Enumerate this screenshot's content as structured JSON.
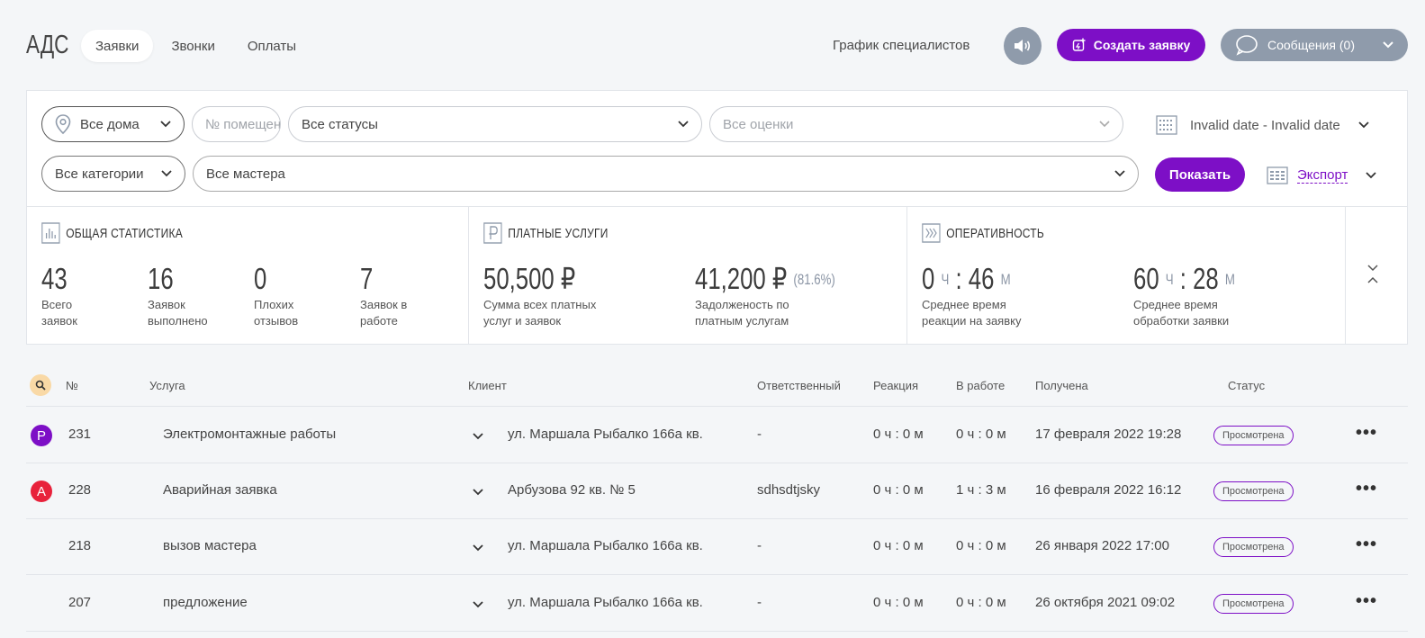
{
  "app": {
    "logo": "АДС"
  },
  "nav": {
    "tabs": [
      {
        "label": "Заявки",
        "active": true
      },
      {
        "label": "Звонки",
        "active": false
      },
      {
        "label": "Оплаты",
        "active": false
      }
    ],
    "schedule_label": "График специалистов",
    "create_label": "Создать заявку",
    "messages_label": "Сообщения (0)"
  },
  "filters": {
    "houses": "Все дома",
    "room_placeholder": "№ помещения",
    "statuses": "Все статусы",
    "ratings_placeholder": "Все оценки",
    "date_range": "Invalid date - Invalid date",
    "categories": "Все категории",
    "masters": "Все мастера",
    "show_label": "Показать",
    "export_label": "Экспорт"
  },
  "stats": {
    "general": {
      "title": "ОБЩАЯ СТАТИСТИКА",
      "items": [
        {
          "value": "43",
          "caption_1": "Всего",
          "caption_2": "заявок"
        },
        {
          "value": "16",
          "caption_1": "Заявок",
          "caption_2": "выполнено"
        },
        {
          "value": "0",
          "caption_1": "Плохих",
          "caption_2": "отзывов"
        },
        {
          "value": "7",
          "caption_1": "Заявок в",
          "caption_2": "работе"
        }
      ]
    },
    "paid": {
      "title": "ПЛАТНЫЕ УСЛУГИ",
      "total": "50,500 ₽",
      "total_caption_1": "Сумма всех платных",
      "total_caption_2": "услуг и заявок",
      "debt": "41,200 ₽",
      "debt_percent": "(81.6%)",
      "debt_caption_1": "Задолженость по",
      "debt_caption_2": "платным услугам"
    },
    "speed": {
      "title": "ОПЕРАТИВНОСТЬ",
      "reaction_h": "0",
      "reaction_m": "46",
      "reaction_caption_1": "Среднее время",
      "reaction_caption_2": "реакции на заявку",
      "processing_h": "60",
      "processing_m": "28",
      "processing_caption_1": "Среднее время",
      "processing_caption_2": "обработки заявки",
      "unit_h": "Ч",
      "unit_m": "М"
    }
  },
  "table": {
    "headers": {
      "num": "№",
      "service": "Услуга",
      "client": "Клиент",
      "responsible": "Ответственный",
      "reaction": "Реакция",
      "in_work": "В работе",
      "received": "Получена",
      "status": "Статус"
    },
    "rows": [
      {
        "badge": "Р",
        "badge_color": "#7d0fc6",
        "num": "231",
        "service": "Электромонтажные работы",
        "address": "ул. Маршала Рыбалко 166а кв.",
        "responsible": "-",
        "reaction": "0 ч : 0 м",
        "in_work": "0 ч : 0 м",
        "received": "17 февраля 2022 19:28",
        "status": "Просмотрена"
      },
      {
        "badge": "А",
        "badge_color": "#e8223b",
        "num": "228",
        "service": "Аварийная заявка",
        "address": "Арбузова 92 кв. № 5",
        "responsible": "sdhsdtjsky",
        "reaction": "0 ч : 0 м",
        "in_work": "1 ч : 3 м",
        "received": "16 февраля 2022 16:12",
        "status": "Просмотрена"
      },
      {
        "badge": "",
        "badge_color": "",
        "num": "218",
        "service": "вызов мастера",
        "address": "ул. Маршала Рыбалко 166а кв.",
        "responsible": "-",
        "reaction": "0 ч : 0 м",
        "in_work": "0 ч : 0 м",
        "received": "26 января 2022 17:00",
        "status": "Просмотрена"
      },
      {
        "badge": "",
        "badge_color": "",
        "num": "207",
        "service": "предложение",
        "address": "ул. Маршала Рыбалко 166а кв.",
        "responsible": "-",
        "reaction": "0 ч : 0 м",
        "in_work": "0 ч : 0 м",
        "received": "26 октября 2021 09:02",
        "status": "Просмотрена"
      }
    ]
  }
}
